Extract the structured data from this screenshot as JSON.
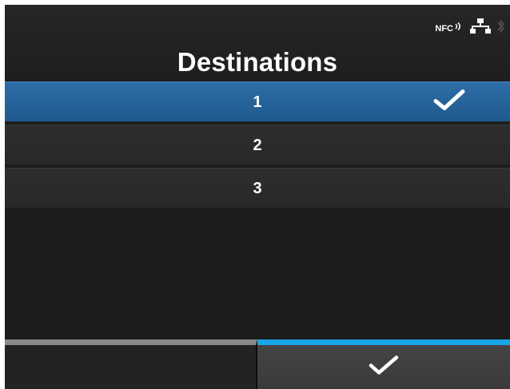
{
  "status_bar": {
    "nfc_label": "NFC",
    "icons": [
      "nfc-icon",
      "network-icon",
      "bluetooth-icon"
    ]
  },
  "title": "Destinations",
  "destinations": [
    {
      "label": "1",
      "selected": true
    },
    {
      "label": "2",
      "selected": false
    },
    {
      "label": "3",
      "selected": false
    }
  ],
  "softkeys": {
    "left": {
      "icon": ""
    },
    "right": {
      "icon": "check-icon"
    }
  },
  "colors": {
    "selected_row": "#2d6da6",
    "active_softkey_accent": "#19a6e8",
    "inactive_softkey_accent": "#8a8a8a",
    "background": "#1e1e1e"
  }
}
